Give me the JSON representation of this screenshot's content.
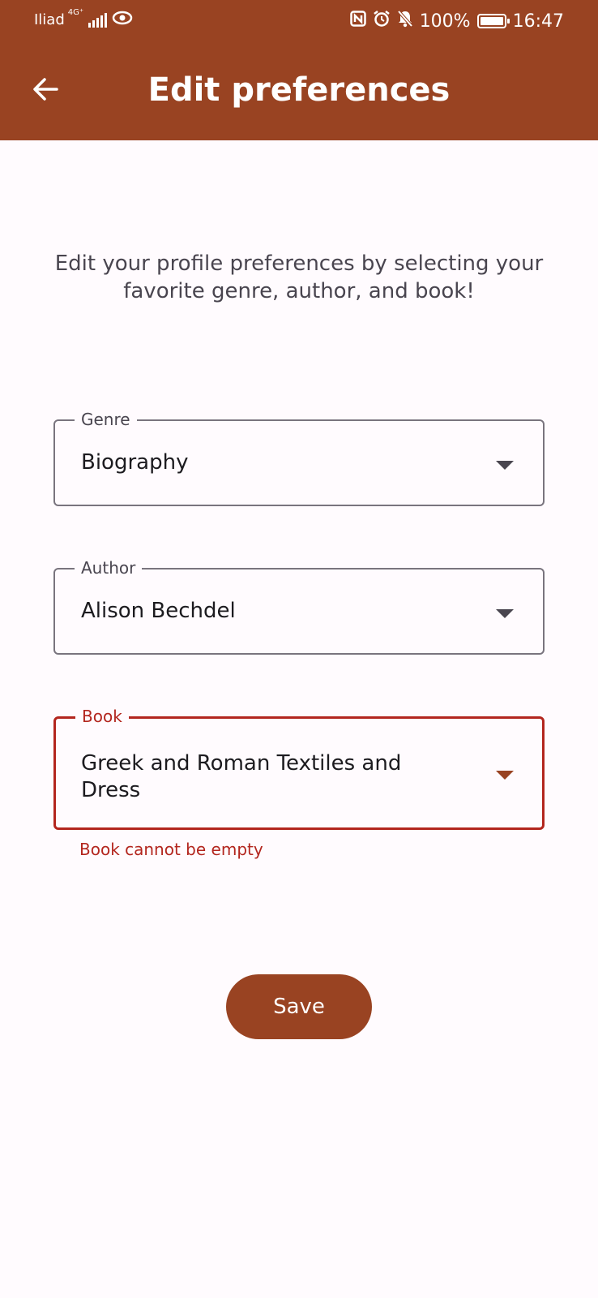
{
  "status_bar": {
    "carrier": "Iliad",
    "network": "4G⁺",
    "battery": "100%",
    "time": "16:47",
    "icons": [
      "signal-icon",
      "eye-icon",
      "nfc-icon",
      "alarm-icon",
      "notifications-off-icon",
      "battery-charging-icon"
    ]
  },
  "app_bar": {
    "back_icon": "arrow-back-icon",
    "title": "Edit preferences",
    "color": "#994322"
  },
  "intro": "Edit your profile preferences by selecting your favorite genre, author, and book!",
  "form": {
    "genre": {
      "label": "Genre",
      "value": "Biography"
    },
    "author": {
      "label": "Author",
      "value": "Alison Bechdel"
    },
    "book": {
      "label": "Book",
      "value": "Greek and Roman Textiles and Dress",
      "error": "Book cannot be empty"
    }
  },
  "save_button": {
    "label": "Save"
  },
  "colors": {
    "primary": "#994322",
    "error": "#b3261e",
    "background": "#fffbfe"
  }
}
